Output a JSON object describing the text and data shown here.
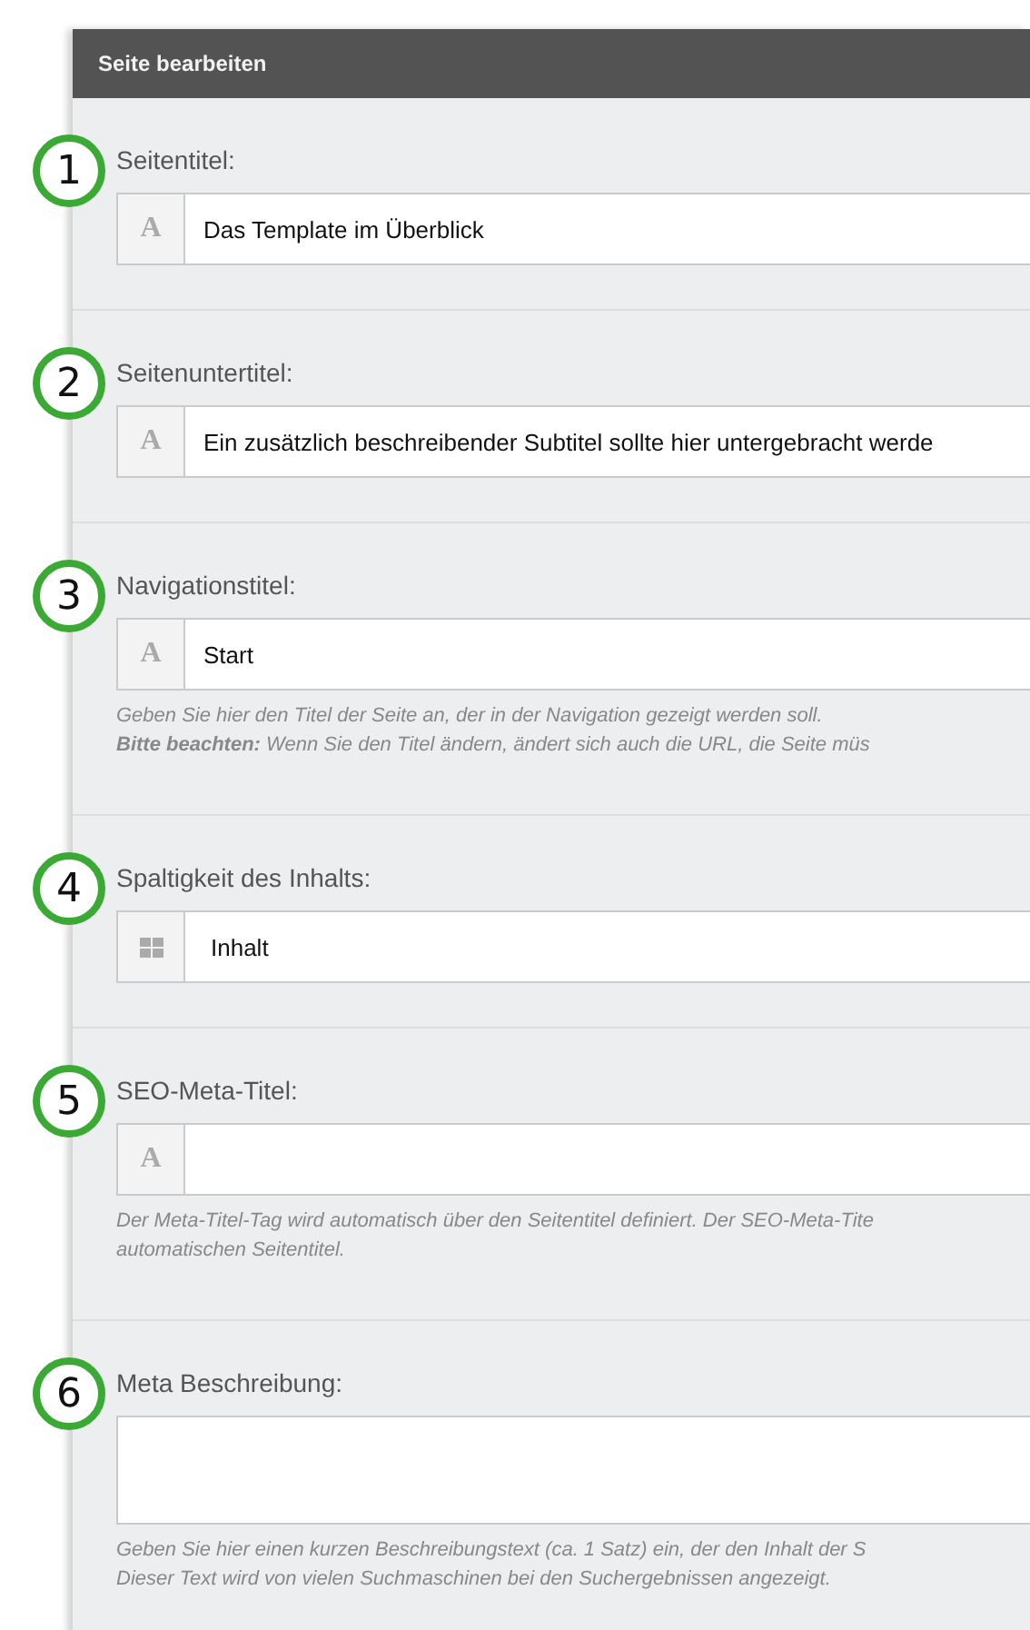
{
  "dialog": {
    "title": "Seite bearbeiten"
  },
  "sections": [
    {
      "number": "1",
      "label": "Seitentitel:",
      "field": {
        "kind": "input",
        "addon": {
          "kind": "letter",
          "text": "A"
        },
        "value": "Das Template im Überblick"
      }
    },
    {
      "number": "2",
      "label": "Seitenuntertitel:",
      "field": {
        "kind": "input",
        "addon": {
          "kind": "letter",
          "text": "A"
        },
        "value": "Ein zusätzlich beschreibender Subtitel sollte hier untergebracht werde"
      }
    },
    {
      "number": "3",
      "label": "Navigationstitel:",
      "field": {
        "kind": "input",
        "addon": {
          "kind": "letter",
          "text": "A"
        },
        "value": "Start"
      },
      "help": [
        "Geben Sie hier den Titel der Seite an, der in der Navigation gezeigt werden soll.",
        "**Bitte beachten:** Wenn Sie den Titel ändern, ändert sich auch die URL, die Seite müs"
      ]
    },
    {
      "number": "4",
      "label": "Spaltigkeit des Inhalts:",
      "field": {
        "kind": "select",
        "addon": {
          "kind": "grid"
        },
        "value": "Inhalt"
      }
    },
    {
      "number": "5",
      "label": "SEO-Meta-Titel:",
      "field": {
        "kind": "input",
        "addon": {
          "kind": "letter",
          "text": "A"
        }
      },
      "help": [
        "Der Meta-Titel-Tag wird automatisch über den Seitentitel definiert. Der SEO-Meta-Tite",
        "automatischen Seitentitel."
      ]
    },
    {
      "number": "6",
      "label": "Meta Beschreibung:",
      "field": {
        "kind": "textarea"
      },
      "help": [
        "Geben Sie hier einen kurzen Beschreibungstext (ca. 1 Satz) ein, der den Inhalt der S",
        "Dieser Text wird von vielen Suchmaschinen bei den Suchergebnissen angezeigt."
      ]
    }
  ]
}
